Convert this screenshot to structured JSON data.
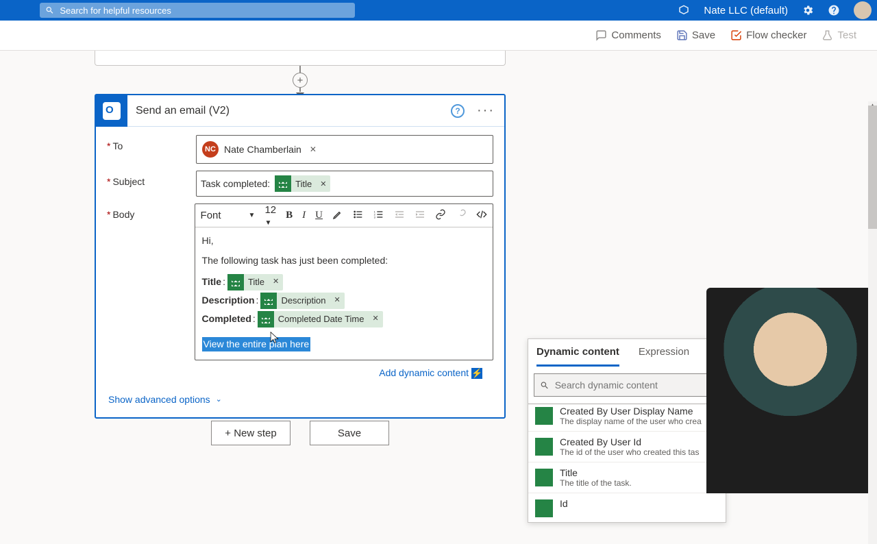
{
  "top": {
    "search_placeholder": "Search for helpful resources",
    "environment": "Nate LLC (default)"
  },
  "commands": {
    "comments": "Comments",
    "save": "Save",
    "flow_checker": "Flow checker",
    "test": "Test"
  },
  "action": {
    "title": "Send an email (V2)",
    "to_label": "To",
    "subject_label": "Subject",
    "body_label": "Body",
    "to_person": {
      "initials": "NC",
      "name": "Nate Chamberlain"
    },
    "subject_prefix": "Task completed:",
    "subject_token": "Title",
    "toolbar": {
      "font_label": "Font",
      "size": "12"
    },
    "body": {
      "greeting": "Hi,",
      "intro": "The following task has just been completed:",
      "title_label": "Title",
      "title_token": "Title",
      "desc_label": "Description",
      "desc_token": "Description",
      "comp_label": "Completed",
      "comp_token": "Completed Date Time",
      "link_text": "View the entire plan here"
    },
    "add_dynamic": "Add dynamic content",
    "show_advanced": "Show advanced options"
  },
  "buttons": {
    "new_step": "+ New step",
    "save": "Save"
  },
  "dc_panel": {
    "tab_dynamic": "Dynamic content",
    "tab_expression": "Expression",
    "search_placeholder": "Search dynamic content",
    "items": [
      {
        "name": "Created By User Display Name",
        "desc": "The display name of the user who crea"
      },
      {
        "name": "Created By User Id",
        "desc": "The id of the user who created this tas"
      },
      {
        "name": "Title",
        "desc": "The title of the task."
      },
      {
        "name": "Id",
        "desc": ""
      }
    ]
  }
}
